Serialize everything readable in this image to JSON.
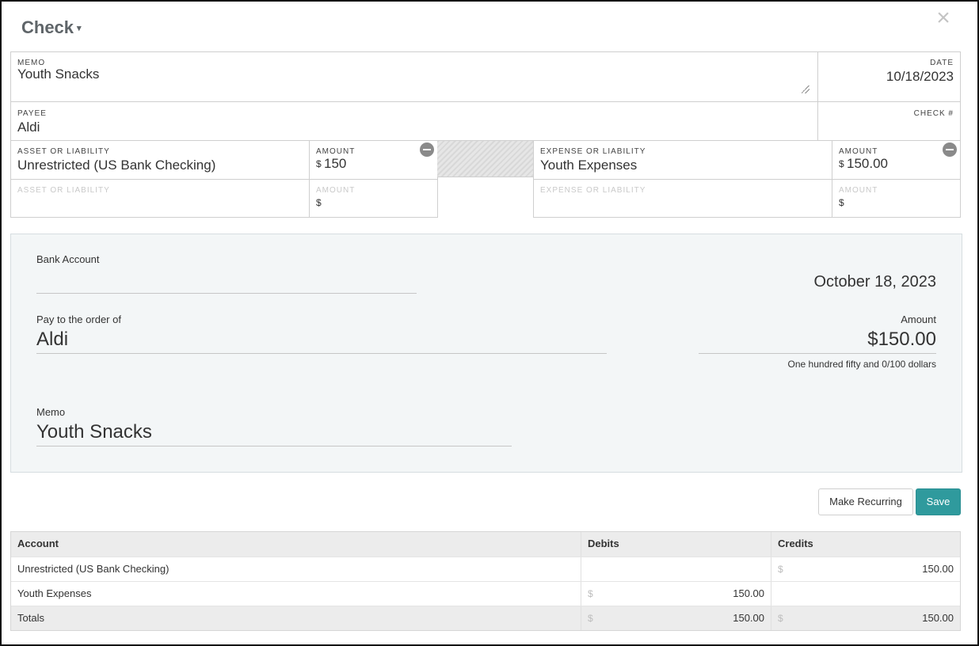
{
  "window": {
    "title": "Check",
    "caret": "▾",
    "close_icon": "×"
  },
  "form": {
    "memo_label": "MEMO",
    "memo_value": "Youth Snacks",
    "date_label": "DATE",
    "date_value": "10/18/2023",
    "payee_label": "PAYEE",
    "payee_value": "Aldi",
    "check_no_label": "CHECK #",
    "check_no_value": "",
    "asset_label": "ASSET OR LIABILITY",
    "asset_amount_label": "AMOUNT",
    "asset_rows": [
      {
        "account": "Unrestricted (US Bank Checking)",
        "currency": "$",
        "amount": "150"
      },
      {
        "account": "",
        "currency": "$",
        "amount": ""
      }
    ],
    "expense_label": "EXPENSE OR LIABILITY",
    "expense_amount_label": "AMOUNT",
    "expense_rows": [
      {
        "account": "Youth Expenses",
        "currency": "$",
        "amount": "150.00"
      },
      {
        "account": "",
        "currency": "$",
        "amount": ""
      }
    ]
  },
  "check": {
    "bank_account_label": "Bank Account",
    "bank_account_value": "",
    "date_long": "October 18, 2023",
    "pay_to_label": "Pay to the order of",
    "pay_to_value": "Aldi",
    "amount_label": "Amount",
    "amount_value": "$150.00",
    "amount_words": "One hundred fifty and 0/100 dollars",
    "memo_label": "Memo",
    "memo_value": "Youth Snacks"
  },
  "buttons": {
    "recurring": "Make Recurring",
    "save": "Save"
  },
  "ledger": {
    "headers": [
      "Account",
      "Debits",
      "Credits"
    ],
    "rows": [
      {
        "account": "Unrestricted (US Bank Checking)",
        "debit_sym": "",
        "debit": "",
        "credit_sym": "$",
        "credit": "150.00"
      },
      {
        "account": "Youth Expenses",
        "debit_sym": "$",
        "debit": "150.00",
        "credit_sym": "",
        "credit": ""
      }
    ],
    "totals": {
      "label": "Totals",
      "debit_sym": "$",
      "debit": "150.00",
      "credit_sym": "$",
      "credit": "150.00"
    }
  },
  "colors": {
    "accent": "#2f9a9d",
    "check_bg": "#f3f6f7"
  }
}
